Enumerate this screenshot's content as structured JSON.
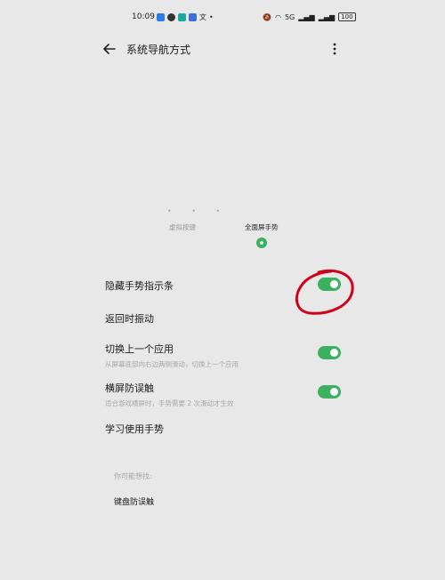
{
  "status_bar": {
    "time": "10:09",
    "battery": "100",
    "signal_text": "5G"
  },
  "header": {
    "title": "系统导航方式",
    "back_icon": "arrow-left-icon",
    "more_icon": "more-vertical-icon"
  },
  "nav_options": {
    "virtual_keys_label": "虚拟按键",
    "gesture_label": "全面屏手势",
    "selected": "gesture"
  },
  "settings": [
    {
      "title": "隐藏手势指示条",
      "subtitle": "",
      "toggle": true
    },
    {
      "title": "返回时振动",
      "subtitle": "",
      "toggle": null
    },
    {
      "title": "切换上一个应用",
      "subtitle": "从屏幕底部向右边两侧滑动，切换上一个应用",
      "toggle": true
    },
    {
      "title": "横屏防误触",
      "subtitle": "适合游戏横屏时，手势需要 2 次滑动才生效",
      "toggle": true
    },
    {
      "title": "学习使用手势",
      "subtitle": "",
      "toggle": null
    }
  ],
  "hint": {
    "label": "你可能想找:",
    "link": "键盘防误触"
  },
  "colors": {
    "background": "#e8e8e8",
    "accent": "#3bb05f",
    "annotation": "#d0021b"
  }
}
